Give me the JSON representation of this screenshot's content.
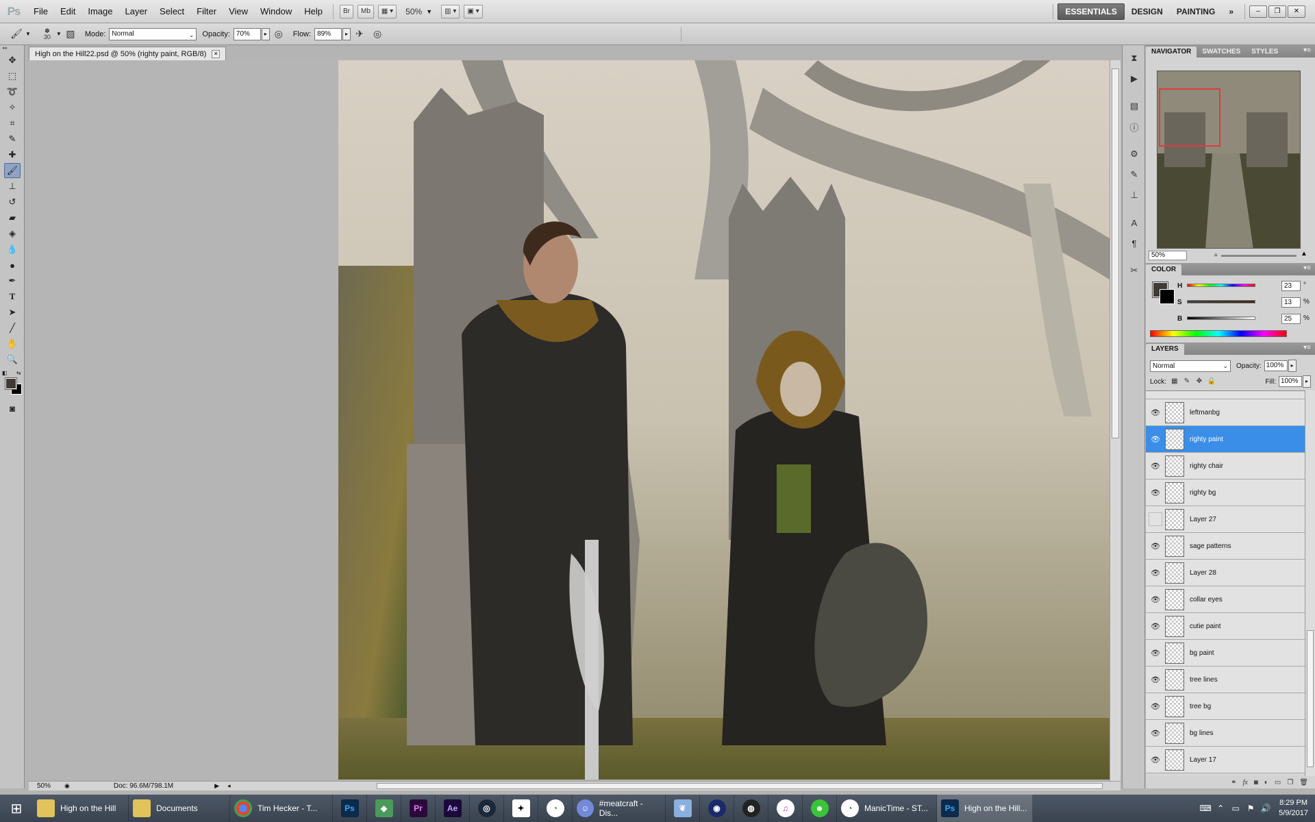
{
  "menubar": {
    "logo": "Ps",
    "items": [
      "File",
      "Edit",
      "Image",
      "Layer",
      "Select",
      "Filter",
      "View",
      "Window",
      "Help"
    ],
    "bridge_btn": "Br",
    "mini_bridge_btn": "Mb",
    "zoom": "50%",
    "workspaces": [
      "ESSENTIALS",
      "DESIGN",
      "PAINTING"
    ],
    "more": "»"
  },
  "options": {
    "brush_size": "30",
    "mode_label": "Mode:",
    "mode_value": "Normal",
    "opacity_label": "Opacity:",
    "opacity_value": "70%",
    "flow_label": "Flow:",
    "flow_value": "89%"
  },
  "document": {
    "tab_title": "High on the Hill22.psd @ 50% (righty paint, RGB/8)",
    "status_zoom": "50%",
    "status_doc": "Doc: 96.6M/798.1M"
  },
  "navigator": {
    "tabs": [
      "NAVIGATOR",
      "SWATCHES",
      "STYLES"
    ],
    "zoom": "50%"
  },
  "color": {
    "title": "COLOR",
    "fg": "#3f3a35",
    "bg": "#000000",
    "h_label": "H",
    "h_value": "23",
    "h_unit": "°",
    "s_label": "S",
    "s_value": "13",
    "s_unit": "%",
    "b_label": "B",
    "b_value": "25",
    "b_unit": "%"
  },
  "layers": {
    "title": "LAYERS",
    "blend_mode": "Normal",
    "opacity_label": "Opacity:",
    "opacity_value": "100%",
    "lock_label": "Lock:",
    "fill_label": "Fill:",
    "fill_value": "100%",
    "items": [
      {
        "name": "leftmanbg",
        "visible": true,
        "selected": false
      },
      {
        "name": "righty paint",
        "visible": true,
        "selected": true
      },
      {
        "name": "righty chair",
        "visible": true,
        "selected": false
      },
      {
        "name": "righty bg",
        "visible": true,
        "selected": false
      },
      {
        "name": "Layer 27",
        "visible": false,
        "selected": false
      },
      {
        "name": "sage patterns",
        "visible": true,
        "selected": false
      },
      {
        "name": "Layer 28",
        "visible": true,
        "selected": false
      },
      {
        "name": "collar eyes",
        "visible": true,
        "selected": false
      },
      {
        "name": "cutie paint",
        "visible": true,
        "selected": false
      },
      {
        "name": "bg paint",
        "visible": true,
        "selected": false
      },
      {
        "name": "tree lines",
        "visible": true,
        "selected": false
      },
      {
        "name": "tree bg",
        "visible": true,
        "selected": false
      },
      {
        "name": "bg lines",
        "visible": true,
        "selected": false
      },
      {
        "name": "Layer 17",
        "visible": true,
        "selected": false
      }
    ]
  },
  "taskbar": {
    "items": [
      {
        "label": "High on the Hill",
        "icon": "folder-icon"
      },
      {
        "label": "Documents",
        "icon": "folder-icon"
      },
      {
        "label": "Tim Hecker - T...",
        "icon": "chrome-icon"
      },
      {
        "label": "#meatcraft - Dis...",
        "icon": "discord-icon"
      },
      {
        "label": "ManicTime - ST...",
        "icon": "manictime-icon"
      },
      {
        "label": "High on the Hill...",
        "icon": "photoshop-icon"
      }
    ],
    "app_icons": {
      "ps": "Ps",
      "pr": "Pr",
      "ae": "Ae"
    },
    "time": "8:29 PM",
    "date": "5/9/2017"
  }
}
